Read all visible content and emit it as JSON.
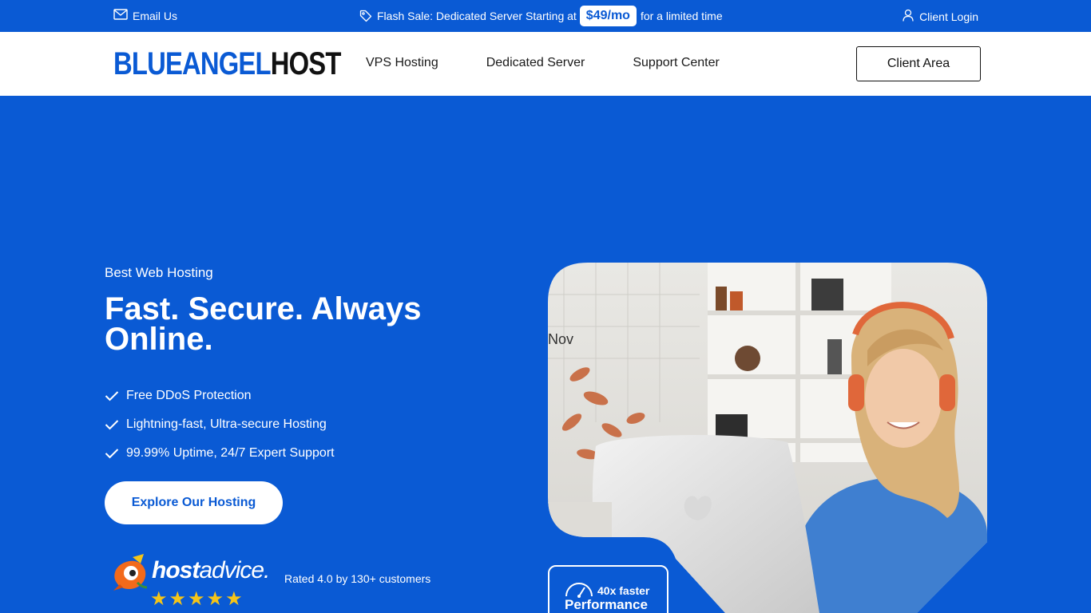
{
  "topbar": {
    "email_label": "Email Us",
    "promo_text": "Flash Sale: Dedicated Server Starting at",
    "promo_price": "$49/mo",
    "promo_suffix": "for a limited time",
    "login_label": "Client Login"
  },
  "header": {
    "logo_part1": "BLUEANGEL",
    "logo_part2": "HOST",
    "nav": [
      {
        "label": "VPS Hosting"
      },
      {
        "label": "Dedicated Server"
      },
      {
        "label": "Support Center"
      }
    ],
    "client_area_label": "Client Area"
  },
  "hero": {
    "eyebrow": "Best Web Hosting",
    "headline": "Fast. Secure. Always Online.",
    "features": [
      {
        "label": "Free DDoS Protection"
      },
      {
        "label": "Lightning-fast, Ultra-secure Hosting"
      },
      {
        "label": "99.99% Uptime, 24/7 Expert Support"
      }
    ],
    "cta_label": "Explore Our Hosting",
    "review_brand_part1": "host",
    "review_brand_part2": "advice.",
    "stars": "★★★★★",
    "rating_text": "Rated 4.0 by 130+ customers"
  },
  "badge": {
    "top": "40x faster",
    "bottom": "Performance"
  },
  "colors": {
    "brand_blue": "#0a5ad4",
    "star_gold": "#f5c518"
  }
}
